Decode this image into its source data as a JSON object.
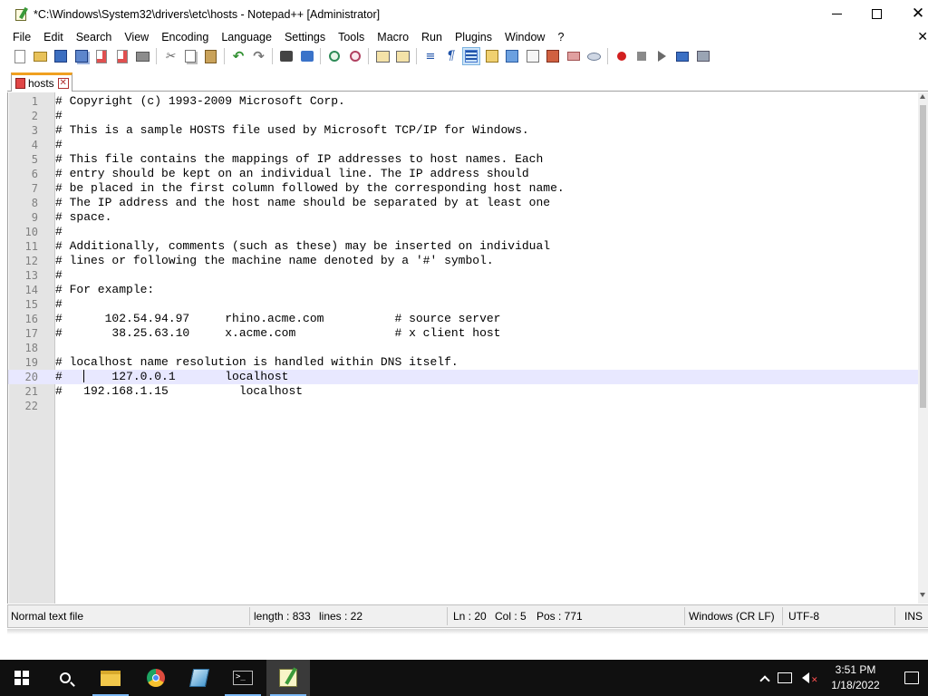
{
  "window": {
    "title": "*C:\\Windows\\System32\\drivers\\etc\\hosts - Notepad++ [Administrator]",
    "close_glyph": "✕",
    "minimize_glyph": "",
    "maximize_glyph": ""
  },
  "menu": {
    "items": [
      "File",
      "Edit",
      "Search",
      "View",
      "Encoding",
      "Language",
      "Settings",
      "Tools",
      "Macro",
      "Run",
      "Plugins",
      "Window",
      "?"
    ],
    "close_doc_glyph": "✕"
  },
  "toolbar": {
    "buttons": [
      "new-file",
      "open-file",
      "save",
      "save-all",
      "close",
      "close-all",
      "print",
      "cut",
      "copy",
      "paste",
      "undo",
      "redo",
      "find",
      "replace",
      "zoom-in",
      "zoom-out",
      "sync-vertical",
      "sync-horizontal",
      "word-wrap",
      "show-all-characters",
      "indent-guide",
      "user-defined-language",
      "document-map",
      "function-list",
      "folder-as-workspace",
      "fold-all",
      "monitoring",
      "record-macro",
      "stop-recording",
      "playback-macro",
      "run-macro-multiple",
      "save-macro"
    ],
    "active_button": "indent-guide"
  },
  "tab": {
    "label": "hosts",
    "close_glyph": "✕",
    "icon": "unsaved-file-icon"
  },
  "editor": {
    "current_line": 20,
    "lines": [
      {
        "n": "1",
        "text": "# Copyright (c) 1993-2009 Microsoft Corp."
      },
      {
        "n": "2",
        "text": "#"
      },
      {
        "n": "3",
        "text": "# This is a sample HOSTS file used by Microsoft TCP/IP for Windows."
      },
      {
        "n": "4",
        "text": "#"
      },
      {
        "n": "5",
        "text": "# This file contains the mappings of IP addresses to host names. Each"
      },
      {
        "n": "6",
        "text": "# entry should be kept on an individual line. The IP address should"
      },
      {
        "n": "7",
        "text": "# be placed in the first column followed by the corresponding host name."
      },
      {
        "n": "8",
        "text": "# The IP address and the host name should be separated by at least one"
      },
      {
        "n": "9",
        "text": "# space."
      },
      {
        "n": "10",
        "text": "#"
      },
      {
        "n": "11",
        "text": "# Additionally, comments (such as these) may be inserted on individual"
      },
      {
        "n": "12",
        "text": "# lines or following the machine name denoted by a '#' symbol."
      },
      {
        "n": "13",
        "text": "#"
      },
      {
        "n": "14",
        "text": "# For example:"
      },
      {
        "n": "15",
        "text": "#"
      },
      {
        "n": "16",
        "text": "#      102.54.94.97     rhino.acme.com          # source server"
      },
      {
        "n": "17",
        "text": "#       38.25.63.10     x.acme.com              # x client host"
      },
      {
        "n": "18",
        "text": ""
      },
      {
        "n": "19",
        "text": "# localhost name resolution is handled within DNS itself."
      },
      {
        "n": "20",
        "text": "#       127.0.0.1       localhost"
      },
      {
        "n": "21",
        "text": "#   192.168.1.15          localhost"
      },
      {
        "n": "22",
        "text": ""
      }
    ]
  },
  "status": {
    "file_type": "Normal text file",
    "length": "length : 833",
    "lines": "lines : 22",
    "ln": "Ln : 20",
    "col": "Col : 5",
    "pos": "Pos : 771",
    "eol": "Windows (CR LF)",
    "encoding": "UTF-8",
    "mode": "INS"
  },
  "taskbar": {
    "apps": [
      "start",
      "search",
      "file-explorer",
      "chrome",
      "virtual-machine",
      "command-prompt",
      "notepad-plus-plus"
    ],
    "active_app": "notepad-plus-plus",
    "clock_time": "3:51 PM",
    "clock_date": "1/18/2022",
    "cmd_glyph": ">_"
  }
}
